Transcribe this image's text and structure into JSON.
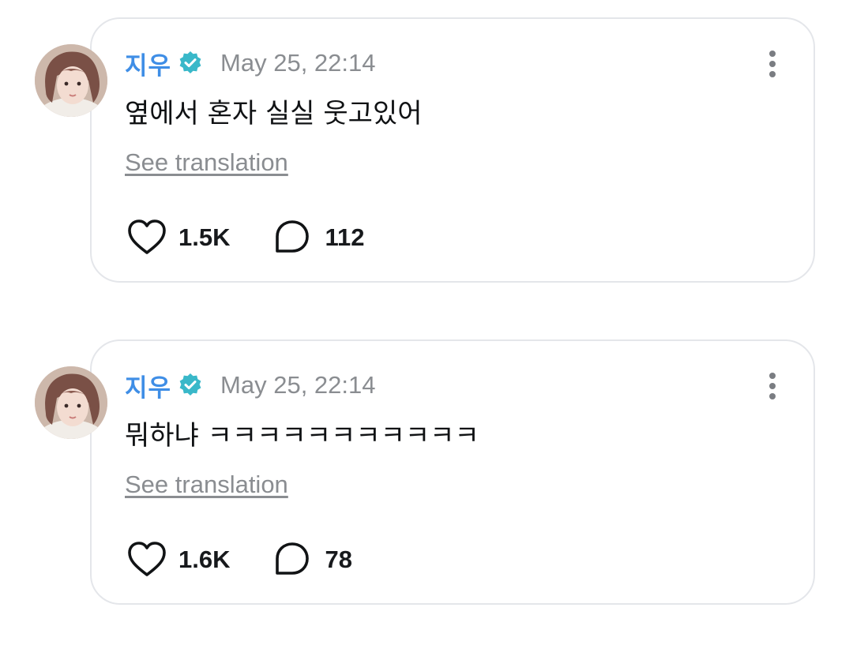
{
  "posts": [
    {
      "author": "지우",
      "verified_icon": "verified-badge-icon",
      "timestamp": "May 25, 22:14",
      "text": "옆에서 혼자 실실 웃고있어",
      "translate_label": "See translation",
      "likes": "1.5K",
      "comments": "112"
    },
    {
      "author": "지우",
      "verified_icon": "verified-badge-icon",
      "timestamp": "May 25, 22:14",
      "text": "뭐하냐 ㅋㅋㅋㅋㅋㅋㅋㅋㅋㅋㅋ",
      "translate_label": "See translation",
      "likes": "1.6K",
      "comments": "78"
    }
  ],
  "colors": {
    "author": "#3f8ee6",
    "verified": "#39b8c9",
    "muted": "#8a8d91",
    "text": "#101214",
    "border": "#e4e6ea"
  }
}
